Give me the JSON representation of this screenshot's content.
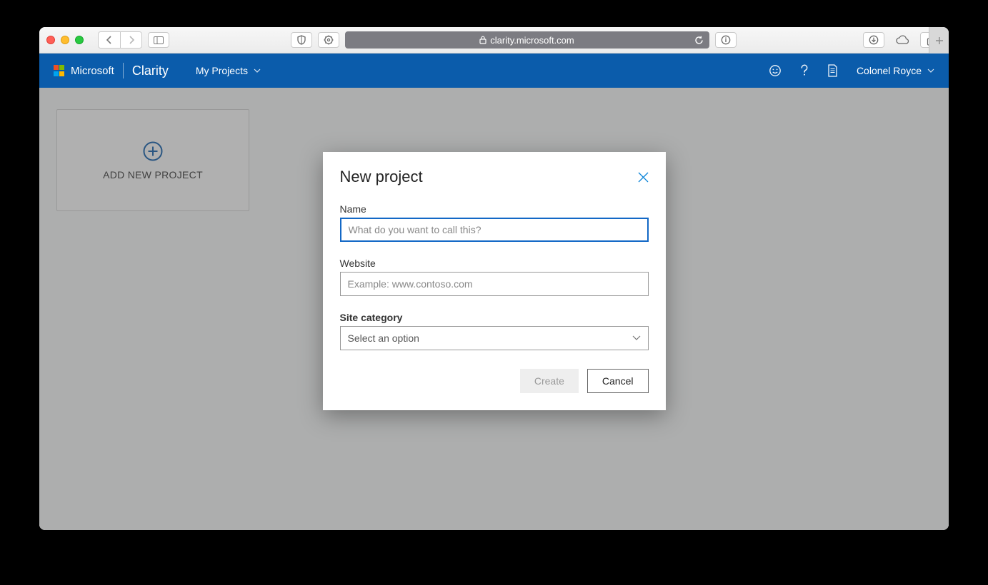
{
  "browser": {
    "url": "clarity.microsoft.com"
  },
  "header": {
    "brand_company": "Microsoft",
    "brand_product": "Clarity",
    "nav_label": "My Projects",
    "user_name": "Colonel Royce"
  },
  "main": {
    "tile_label": "ADD NEW PROJECT"
  },
  "modal": {
    "title": "New project",
    "name_label": "Name",
    "name_placeholder": "What do you want to call this?",
    "website_label": "Website",
    "website_placeholder": "Example: www.contoso.com",
    "category_label": "Site category",
    "category_placeholder": "Select an option",
    "create_label": "Create",
    "cancel_label": "Cancel"
  }
}
